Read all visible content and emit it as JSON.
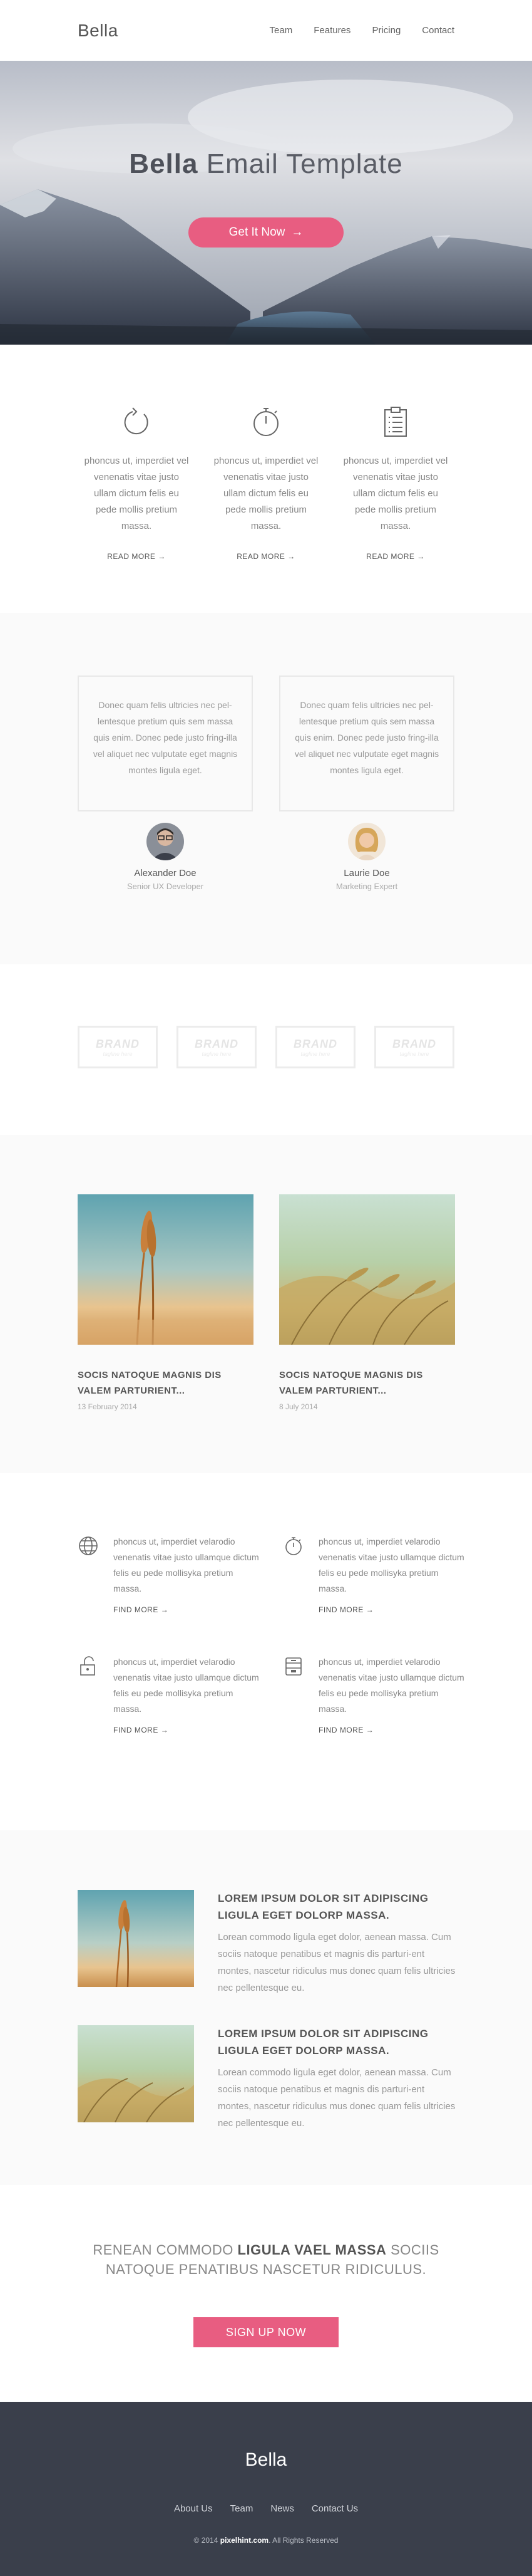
{
  "header": {
    "logo": "Bella",
    "nav": [
      "Team",
      "Features",
      "Pricing",
      "Contact"
    ]
  },
  "hero": {
    "title_bold": "Bella",
    "title_light": "Email Template",
    "cta_label": "Get It Now",
    "cta_arrow": "→"
  },
  "features": {
    "items": [
      {
        "icon": "refresh-icon",
        "text": "phoncus ut, imperdiet vel venenatis vitae justo ullam dictum felis eu pede mollis pretium massa.",
        "more": "READ MORE",
        "arrow": "→"
      },
      {
        "icon": "stopwatch-icon",
        "text": "phoncus ut, imperdiet vel venenatis vitae justo ullam dictum felis eu pede mollis pretium massa.",
        "more": "READ MORE",
        "arrow": "→"
      },
      {
        "icon": "clipboard-icon",
        "text": "phoncus ut, imperdiet vel venenatis vitae justo ullam dictum felis eu pede mollis pretium massa.",
        "more": "READ MORE",
        "arrow": "→"
      }
    ]
  },
  "testimonials": {
    "items": [
      {
        "quote": "Donec quam felis ultricies nec pel-lentesque pretium quis sem massa quis enim. Donec pede justo fring-illa vel aliquet nec vulputate eget magnis montes ligula eget.",
        "name": "Alexander Doe",
        "role": "Senior UX Developer"
      },
      {
        "quote": "Donec quam felis ultricies nec pel-lentesque pretium quis sem massa quis enim. Donec pede justo fring-illa vel aliquet nec vulputate eget magnis montes ligula eget.",
        "name": "Laurie Doe",
        "role": "Marketing Expert"
      }
    ]
  },
  "brands": {
    "items": [
      {
        "name": "BRAND",
        "tagline": "tagline here"
      },
      {
        "name": "BRAND",
        "tagline": "tagline here"
      },
      {
        "name": "BRAND",
        "tagline": "tagline here"
      },
      {
        "name": "BRAND",
        "tagline": "tagline here"
      }
    ]
  },
  "news": {
    "items": [
      {
        "title": "SOCIS NATOQUE MAGNIS DIS VALEM PARTURIENT...",
        "date": "13 February 2014"
      },
      {
        "title": "SOCIS NATOQUE MAGNIS DIS VALEM PARTURIENT...",
        "date": "8 July 2014"
      }
    ]
  },
  "findmore": {
    "items": [
      {
        "icon": "globe-icon",
        "text": "phoncus ut, imperdiet velarodio venenatis vitae justo ullamque dictum felis eu pede mollisyka pretium massa.",
        "more": "FIND MORE",
        "arrow": "→"
      },
      {
        "icon": "timer-icon",
        "text": "phoncus ut, imperdiet velarodio venenatis vitae justo ullamque dictum felis eu pede mollisyka pretium massa.",
        "more": "FIND MORE",
        "arrow": "→"
      },
      {
        "icon": "unlock-icon",
        "text": "phoncus ut, imperdiet velarodio venenatis vitae justo ullamque dictum felis eu pede mollisyka pretium massa.",
        "more": "FIND MORE",
        "arrow": "→"
      },
      {
        "icon": "archive-icon",
        "text": "phoncus ut, imperdiet velarodio venenatis vitae justo ullamque dictum felis eu pede mollisyka pretium massa.",
        "more": "FIND MORE",
        "arrow": "→"
      }
    ]
  },
  "articles": {
    "items": [
      {
        "title": "LOREM IPSUM DOLOR SIT ADIPISCING LIGULA EGET DOLORP MASSA.",
        "text": "Lorean commodo ligula eget dolor, aenean massa. Cum sociis natoque penatibus et magnis dis parturi-ent montes, nascetur ridiculus mus donec quam felis ultricies nec pellentesque eu."
      },
      {
        "title": "LOREM IPSUM DOLOR SIT ADIPISCING LIGULA EGET DOLORP MASSA.",
        "text": "Lorean commodo ligula eget dolor, aenean massa. Cum sociis natoque penatibus et magnis dis parturi-ent montes, nascetur ridiculus mus donec quam felis ultricies nec pellentesque eu."
      }
    ]
  },
  "cta": {
    "text_part1": "RENEAN COMMODO",
    "text_bold": "LIGULA VAEL MASSA",
    "text_part2": "SOCIIS NATOQUE PENATIBUS NASCETUR RIDICULUS.",
    "button": "SIGN UP NOW"
  },
  "footer": {
    "logo": "Bella",
    "nav": [
      "About Us",
      "Team",
      "News",
      "Contact Us"
    ],
    "copy_prefix": "© 2014",
    "copy_site": "pixelhint.com",
    "copy_suffix": ". All Rights Reserved"
  },
  "colors": {
    "accent": "#e85d81",
    "footer_bg": "#3a3f4b",
    "section_alt": "#fafafa"
  }
}
